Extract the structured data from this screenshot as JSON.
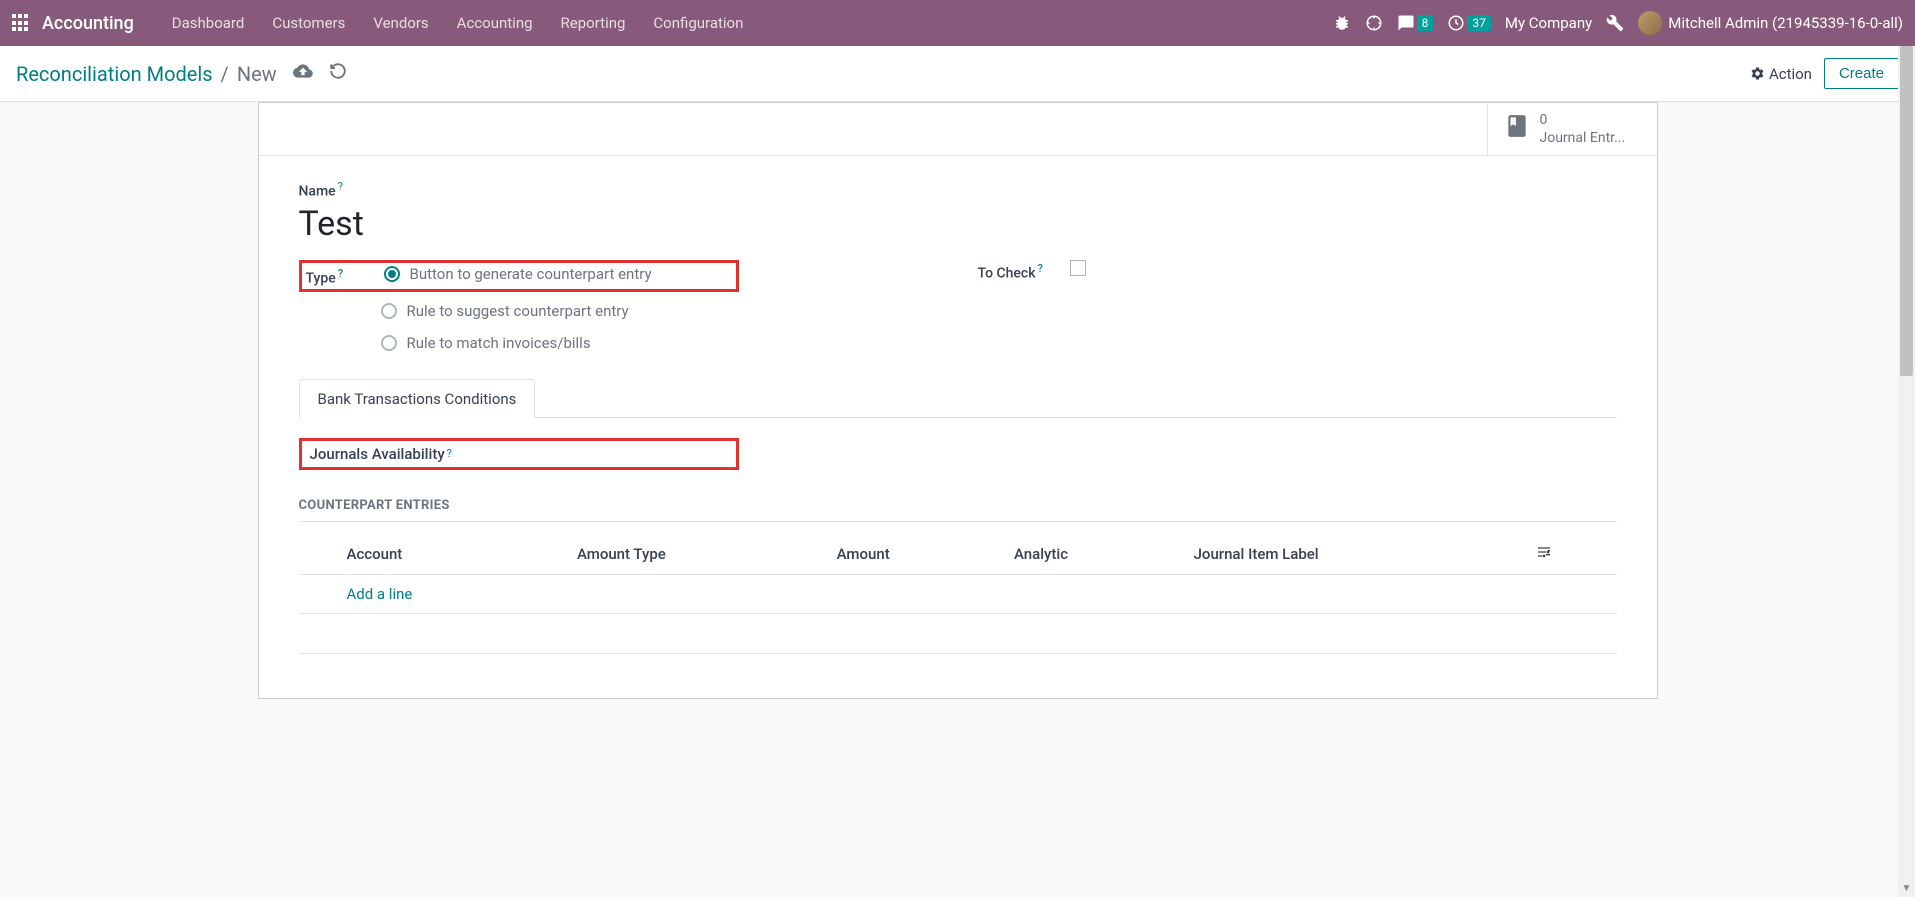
{
  "nav": {
    "brand": "Accounting",
    "items": [
      "Dashboard",
      "Customers",
      "Vendors",
      "Accounting",
      "Reporting",
      "Configuration"
    ],
    "messages_count": "8",
    "activities_count": "37",
    "company": "My Company",
    "user": "Mitchell Admin (21945339-16-0-all)"
  },
  "breadcrumb": {
    "parent": "Reconciliation Models",
    "current": "New"
  },
  "actions": {
    "action_label": "Action",
    "create_label": "Create"
  },
  "stat": {
    "count": "0",
    "label": "Journal Entr..."
  },
  "form": {
    "name_label": "Name",
    "name_value": "Test",
    "type_label": "Type",
    "type_options": [
      "Button to generate counterpart entry",
      "Rule to suggest counterpart entry",
      "Rule to match invoices/bills"
    ],
    "to_check_label": "To Check"
  },
  "tabs": {
    "bank_conditions": "Bank Transactions Conditions"
  },
  "tab_content": {
    "journals_label": "Journals Availability",
    "counterpart_heading": "Counterpart Entries",
    "columns": {
      "account": "Account",
      "amount_type": "Amount Type",
      "amount": "Amount",
      "analytic": "Analytic",
      "journal_item_label": "Journal Item Label"
    },
    "add_line": "Add a line"
  }
}
